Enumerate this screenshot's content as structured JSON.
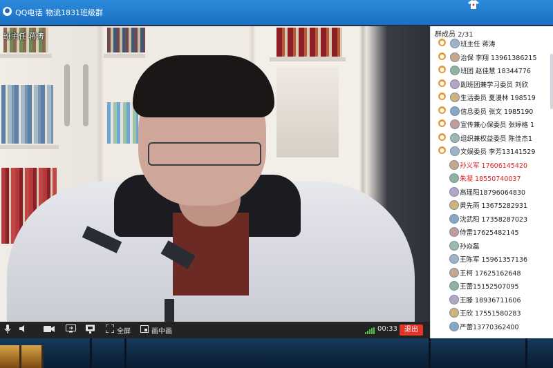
{
  "window": {
    "app_title": "QQ电话",
    "separator": "-",
    "group_name": "物流1831班级群"
  },
  "video": {
    "caller_label": "班主任 蒋涛"
  },
  "toolbar": {
    "fullscreen_label": "全屏",
    "pip_label": "画中画",
    "timer": "00:33",
    "exit_label": "退出"
  },
  "panel": {
    "title": "群成员 2/31",
    "members": [
      {
        "text": "班主任 蒋涛",
        "style": "top"
      },
      {
        "text": "治保 李翔 13961386215",
        "style": "top"
      },
      {
        "text": "班团 赵佳慧 18344776",
        "style": "top"
      },
      {
        "text": "副班团兼学习委员 刘欣",
        "style": "top"
      },
      {
        "text": "生活委员 夏漫林 198519",
        "style": "top"
      },
      {
        "text": "信息委员 张文 1985190",
        "style": "top"
      },
      {
        "text": "宣传兼心保委员 张婷格 1",
        "style": "top"
      },
      {
        "text": "组织兼权益委员 陈佳杰1",
        "style": "top"
      },
      {
        "text": "文娱委员 李芳13141529",
        "style": "top"
      },
      {
        "text": "孙义军  17606145420",
        "style": "red"
      },
      {
        "text": "朱凝 18550740037",
        "style": "red"
      },
      {
        "text": "高瑶阳18796064830",
        "style": "sub"
      },
      {
        "text": "黄先雨 13675282931",
        "style": "sub"
      },
      {
        "text": "沈武阳  17358287023",
        "style": "sub"
      },
      {
        "text": "侍雷17625482145",
        "style": "sub"
      },
      {
        "text": "孙焱磊",
        "style": "sub"
      },
      {
        "text": "王陈军 15961357136",
        "style": "sub"
      },
      {
        "text": "王柯    17625162648",
        "style": "sub"
      },
      {
        "text": "王蕾15152507095",
        "style": "sub"
      },
      {
        "text": "王滕  18936711606",
        "style": "sub"
      },
      {
        "text": "王欣  17551580283",
        "style": "sub"
      },
      {
        "text": "严蕾13770362400",
        "style": "sub"
      }
    ]
  },
  "colors": {
    "titlebar": "#1c6fc2",
    "exit_button": "#e0362b",
    "red_member": "#e02020",
    "signal": "#4cc24c"
  },
  "icons": [
    "qq-logo-icon",
    "skin-shirt-icon",
    "mic-icon",
    "speaker-icon",
    "camera-icon",
    "share-screen-icon",
    "monitor-icon",
    "fullscreen-icon",
    "pip-icon",
    "signal-icon",
    "role-person-icon",
    "avatar-icon"
  ]
}
